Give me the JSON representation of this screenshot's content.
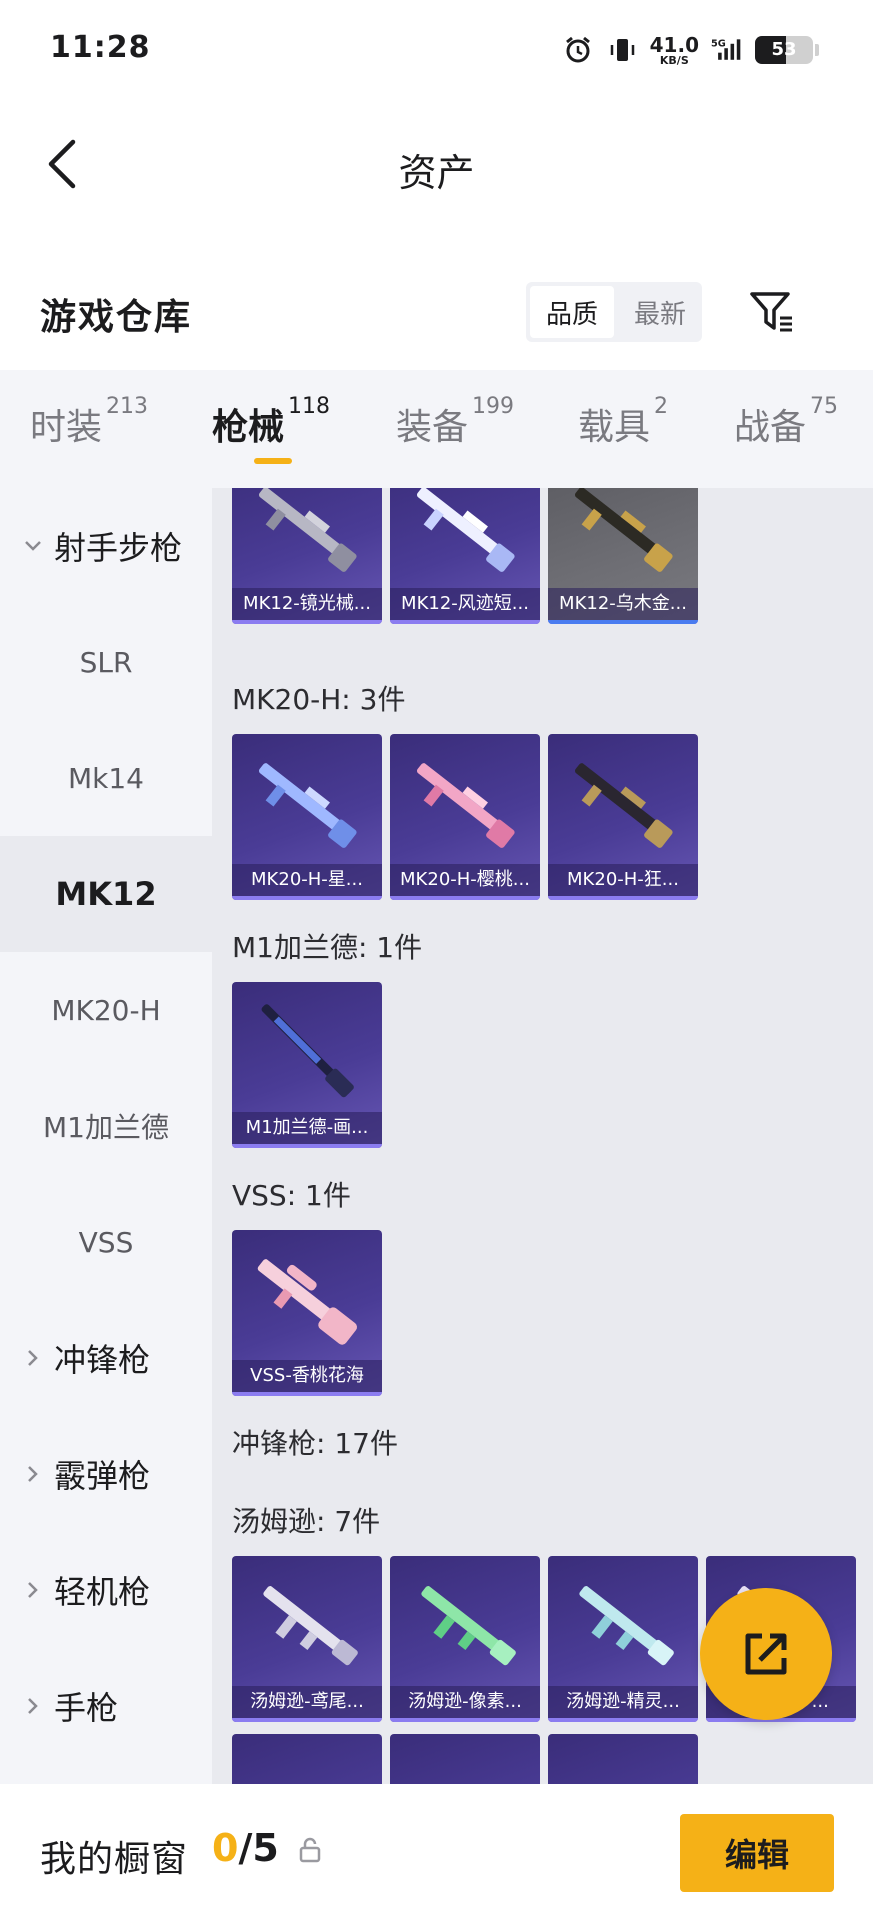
{
  "status_bar": {
    "time": "11:28",
    "net_speed": "41.0",
    "net_unit": "KB/S",
    "network": "5G",
    "battery": "53"
  },
  "nav": {
    "title": "资产"
  },
  "warehouse": {
    "title": "游戏仓库",
    "sort_options": [
      "品质",
      "最新"
    ],
    "active_sort": "品质"
  },
  "tabs": [
    {
      "label": "时装",
      "count": "213"
    },
    {
      "label": "枪械",
      "count": "118",
      "active": true
    },
    {
      "label": "装备",
      "count": "199"
    },
    {
      "label": "载具",
      "count": "2"
    },
    {
      "label": "战备",
      "count": "75"
    }
  ],
  "sidebar": [
    {
      "label": "射手步枪",
      "type": "group-open"
    },
    {
      "label": "SLR"
    },
    {
      "label": "Mk14"
    },
    {
      "label": "MK12",
      "active": true
    },
    {
      "label": "MK20-H"
    },
    {
      "label": "M1加兰德"
    },
    {
      "label": "VSS"
    },
    {
      "label": "冲锋枪",
      "type": "group"
    },
    {
      "label": "霰弹枪",
      "type": "group"
    },
    {
      "label": "轻机枪",
      "type": "group"
    },
    {
      "label": "手枪",
      "type": "group"
    }
  ],
  "content": {
    "mk12_items": [
      "MK12-镜光械...",
      "MK12-风迹短...",
      "MK12-乌木金..."
    ],
    "sections": [
      {
        "label": "MK20-H: 3件",
        "items": [
          "MK20-H-星...",
          "MK20-H-樱桃...",
          "MK20-H-狂..."
        ]
      },
      {
        "label": "M1加兰德: 1件",
        "items": [
          "M1加兰德-画..."
        ]
      },
      {
        "label": "VSS: 1件",
        "items": [
          "VSS-香桃花海"
        ]
      },
      {
        "label": "冲锋枪: 17件"
      },
      {
        "label": "汤姆逊: 7件",
        "items": [
          "汤姆逊-鸢尾...",
          "汤姆逊-像素...",
          "汤姆逊-精灵...",
          "汤姆逊-梦..."
        ]
      }
    ]
  },
  "bottom_bar": {
    "label": "我的橱窗",
    "count_used": "0",
    "count_sep": "/",
    "count_total": "5",
    "edit_label": "编辑"
  },
  "colors": {
    "accent": "#f5b117",
    "card_purple": "#4a3c96",
    "panel_bg": "#e9eaef"
  }
}
